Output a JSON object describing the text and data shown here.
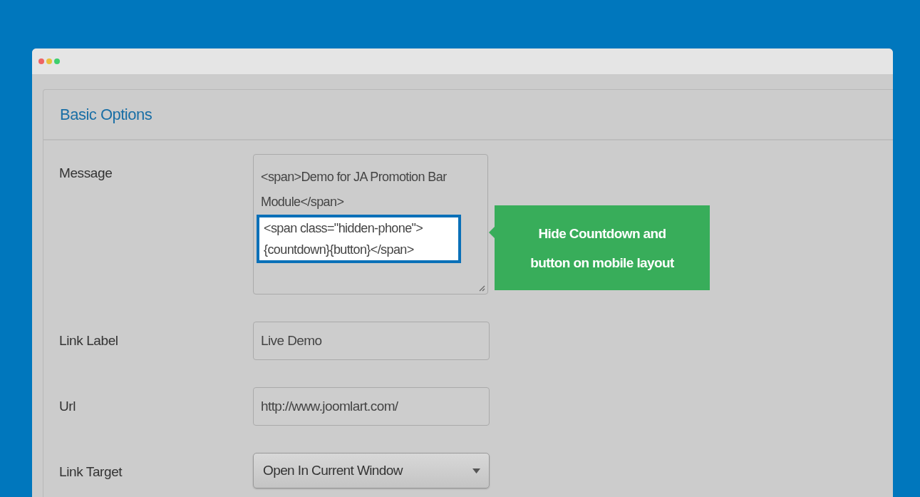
{
  "window": {
    "controls": [
      {
        "color": "#ee6464"
      },
      {
        "color": "#e8c03c"
      },
      {
        "color": "#3ecf6e"
      }
    ]
  },
  "panel": {
    "title": "Basic Options"
  },
  "fields": [
    {
      "kind": "textarea",
      "label": "Message",
      "value": "<span>Demo for JA Promotion Bar Module</span>",
      "highlighted_lines": [
        "<span class=\"hidden-phone\">",
        "{countdown}{button}</span>"
      ],
      "tooltip": "Hide Countdown and button on mobile layout"
    },
    {
      "kind": "text",
      "label": "Link Label",
      "value": "Live Demo"
    },
    {
      "kind": "text",
      "label": "Url",
      "value": "http://www.joomlart.com/"
    },
    {
      "kind": "select",
      "label": "Link Target",
      "value": "Open In Current Window"
    }
  ]
}
